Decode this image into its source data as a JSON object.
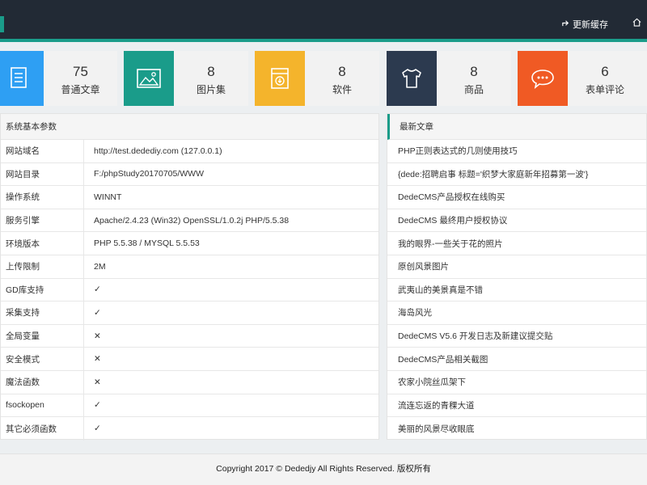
{
  "topbar": {
    "refresh_label": "更新缓存",
    "home_label": "",
    "accent_color": "#1a9c8a",
    "bg_color": "#222a35"
  },
  "stats": [
    {
      "value": "75",
      "label": "普通文章",
      "icon": "list-document-icon",
      "color": "#2e9ff3"
    },
    {
      "value": "8",
      "label": "图片集",
      "icon": "image-icon",
      "color": "#1a9c8a"
    },
    {
      "value": "8",
      "label": "软件",
      "icon": "download-box-icon",
      "color": "#f4b42c"
    },
    {
      "value": "8",
      "label": "商品",
      "icon": "tshirt-icon",
      "color": "#2c3a4f"
    },
    {
      "value": "6",
      "label": "表单评论",
      "icon": "chat-bubble-icon",
      "color": "#f05a24"
    }
  ],
  "sysinfo": {
    "title": "系统基本参数",
    "rows": [
      {
        "key": "网站域名",
        "value": "http://test.dedediy.com (127.0.0.1)"
      },
      {
        "key": "网站目录",
        "value": "F:/phpStudy20170705/WWW"
      },
      {
        "key": "操作系统",
        "value": "WINNT"
      },
      {
        "key": "服务引擎",
        "value": "Apache/2.4.23 (Win32) OpenSSL/1.0.2j PHP/5.5.38"
      },
      {
        "key": "环境版本",
        "value": "PHP 5.5.38 / MYSQL 5.5.53"
      },
      {
        "key": "上传限制",
        "value": "2M"
      },
      {
        "key": "GD库支持",
        "value": "✓"
      },
      {
        "key": "采集支持",
        "value": "✓"
      },
      {
        "key": "全局变量",
        "value": "✕"
      },
      {
        "key": "安全模式",
        "value": "✕"
      },
      {
        "key": "魔法函数",
        "value": "✕"
      },
      {
        "key": "fsockopen",
        "value": "✓"
      },
      {
        "key": "其它必须函数",
        "value": "✓"
      }
    ]
  },
  "articles": {
    "title": "最新文章",
    "items": [
      "PHP正则表达式的几则使用技巧",
      "{dede:招聘启事 标题='织梦大家庭新年招募第一波'}",
      "DedeCMS产品授权在线购买",
      "DedeCMS 最终用户授权协议",
      "我的眼界-一些关于花的照片",
      "原创风景图片",
      "武夷山的美景真是不错",
      "海岛风光",
      "DedeCMS V5.6 开发日志及新建议提交贴",
      "DedeCMS产品相关截图",
      "农家小院丝瓜架下",
      "流连忘返的青稞大道",
      "美丽的风景尽收眼底"
    ]
  },
  "footer": {
    "text": "Copyright 2017 © Dededjy All Rights Reserved. 版权所有"
  }
}
